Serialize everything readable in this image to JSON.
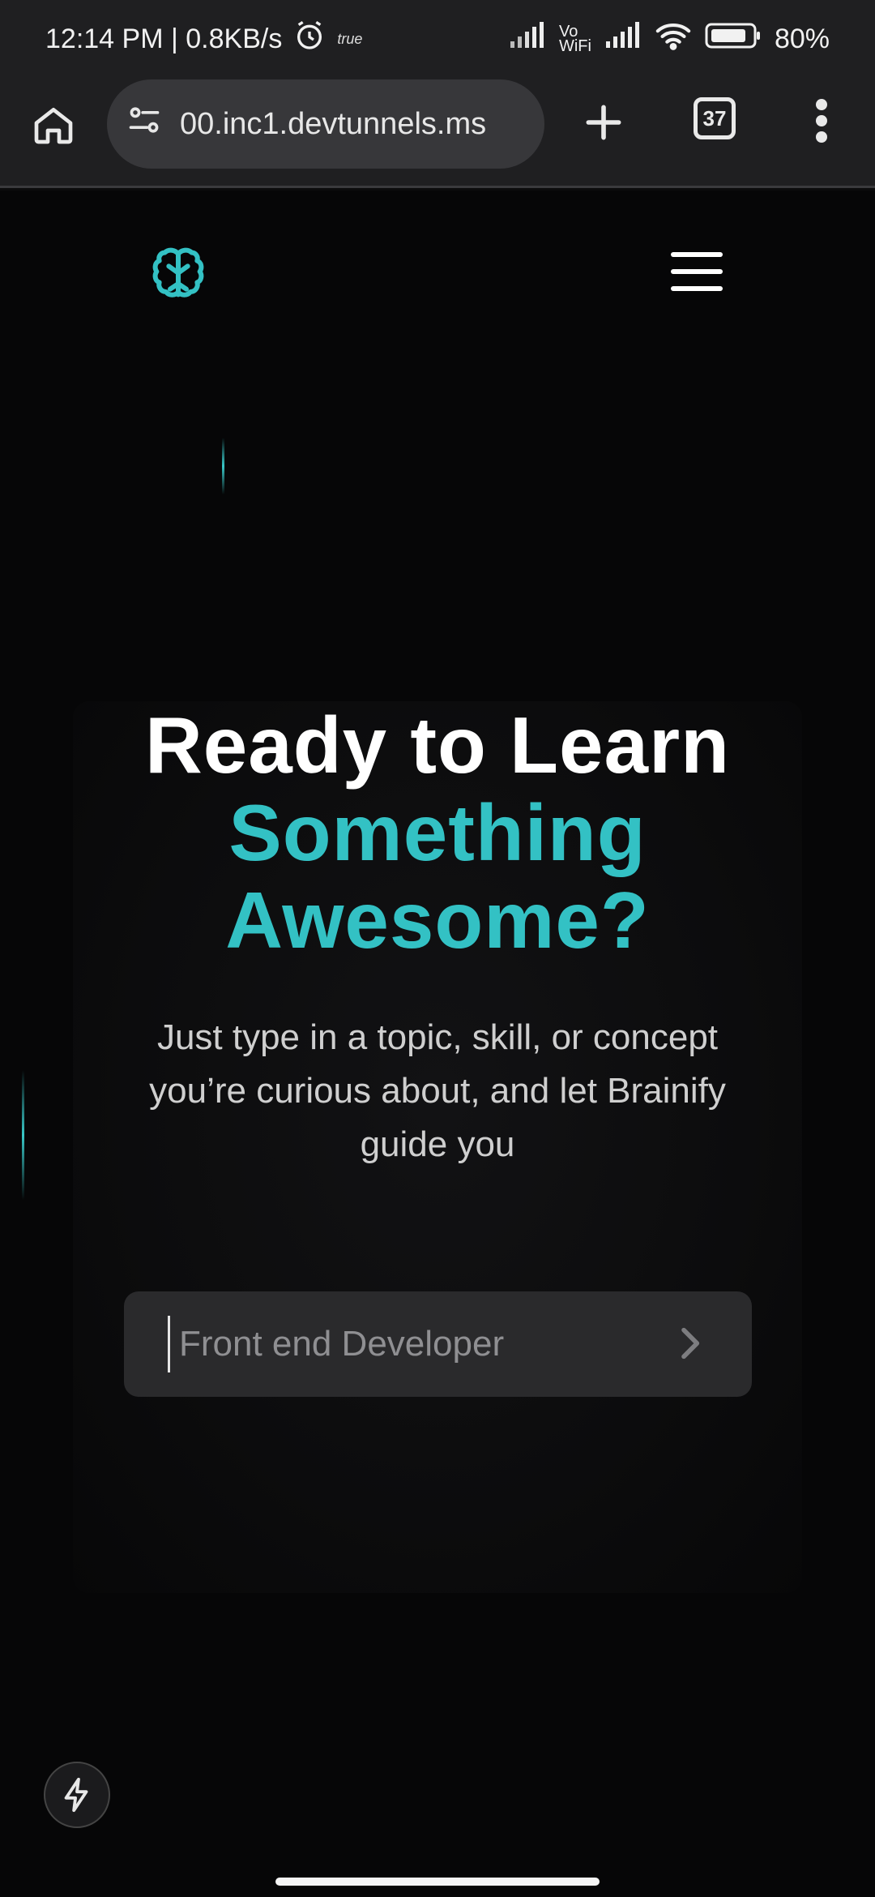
{
  "status_bar": {
    "time_speed": "12:14 PM | 0.8KB/s",
    "carrier_tag": "true",
    "vowifi_top": "Vo",
    "vowifi_bottom": "WiFi",
    "battery": "80%"
  },
  "browser": {
    "url": "00.inc1.devtunnels.ms",
    "tab_count": "37"
  },
  "hero": {
    "headline_line1": "Ready to Learn",
    "headline_line2": "Something",
    "headline_line3": "Awesome?",
    "subtitle": "Just type in a topic, skill, or concept you’re curious about, and let Brainify guide you"
  },
  "search": {
    "placeholder": "Front end Developer",
    "value": ""
  },
  "colors": {
    "accent": "#33c1c4",
    "background": "#060607",
    "chrome": "#1f1f21"
  },
  "icons": {
    "logo": "brain-icon",
    "menu": "hamburger-menu-icon",
    "submit": "chevron-right-icon",
    "fab": "lightning-bolt-icon"
  }
}
